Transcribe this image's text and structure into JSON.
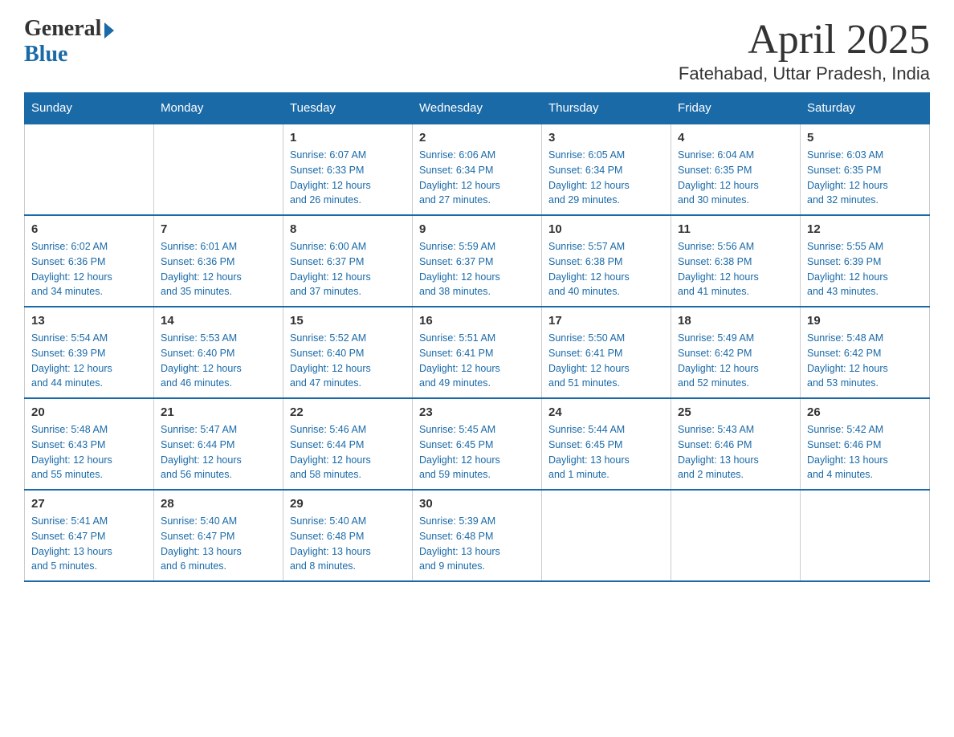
{
  "header": {
    "logo": {
      "general": "General",
      "blue": "Blue"
    },
    "title": "April 2025",
    "subtitle": "Fatehabad, Uttar Pradesh, India"
  },
  "calendar": {
    "headers": [
      "Sunday",
      "Monday",
      "Tuesday",
      "Wednesday",
      "Thursday",
      "Friday",
      "Saturday"
    ],
    "weeks": [
      {
        "days": [
          {
            "number": "",
            "info": ""
          },
          {
            "number": "",
            "info": ""
          },
          {
            "number": "1",
            "info": "Sunrise: 6:07 AM\nSunset: 6:33 PM\nDaylight: 12 hours\nand 26 minutes."
          },
          {
            "number": "2",
            "info": "Sunrise: 6:06 AM\nSunset: 6:34 PM\nDaylight: 12 hours\nand 27 minutes."
          },
          {
            "number": "3",
            "info": "Sunrise: 6:05 AM\nSunset: 6:34 PM\nDaylight: 12 hours\nand 29 minutes."
          },
          {
            "number": "4",
            "info": "Sunrise: 6:04 AM\nSunset: 6:35 PM\nDaylight: 12 hours\nand 30 minutes."
          },
          {
            "number": "5",
            "info": "Sunrise: 6:03 AM\nSunset: 6:35 PM\nDaylight: 12 hours\nand 32 minutes."
          }
        ]
      },
      {
        "days": [
          {
            "number": "6",
            "info": "Sunrise: 6:02 AM\nSunset: 6:36 PM\nDaylight: 12 hours\nand 34 minutes."
          },
          {
            "number": "7",
            "info": "Sunrise: 6:01 AM\nSunset: 6:36 PM\nDaylight: 12 hours\nand 35 minutes."
          },
          {
            "number": "8",
            "info": "Sunrise: 6:00 AM\nSunset: 6:37 PM\nDaylight: 12 hours\nand 37 minutes."
          },
          {
            "number": "9",
            "info": "Sunrise: 5:59 AM\nSunset: 6:37 PM\nDaylight: 12 hours\nand 38 minutes."
          },
          {
            "number": "10",
            "info": "Sunrise: 5:57 AM\nSunset: 6:38 PM\nDaylight: 12 hours\nand 40 minutes."
          },
          {
            "number": "11",
            "info": "Sunrise: 5:56 AM\nSunset: 6:38 PM\nDaylight: 12 hours\nand 41 minutes."
          },
          {
            "number": "12",
            "info": "Sunrise: 5:55 AM\nSunset: 6:39 PM\nDaylight: 12 hours\nand 43 minutes."
          }
        ]
      },
      {
        "days": [
          {
            "number": "13",
            "info": "Sunrise: 5:54 AM\nSunset: 6:39 PM\nDaylight: 12 hours\nand 44 minutes."
          },
          {
            "number": "14",
            "info": "Sunrise: 5:53 AM\nSunset: 6:40 PM\nDaylight: 12 hours\nand 46 minutes."
          },
          {
            "number": "15",
            "info": "Sunrise: 5:52 AM\nSunset: 6:40 PM\nDaylight: 12 hours\nand 47 minutes."
          },
          {
            "number": "16",
            "info": "Sunrise: 5:51 AM\nSunset: 6:41 PM\nDaylight: 12 hours\nand 49 minutes."
          },
          {
            "number": "17",
            "info": "Sunrise: 5:50 AM\nSunset: 6:41 PM\nDaylight: 12 hours\nand 51 minutes."
          },
          {
            "number": "18",
            "info": "Sunrise: 5:49 AM\nSunset: 6:42 PM\nDaylight: 12 hours\nand 52 minutes."
          },
          {
            "number": "19",
            "info": "Sunrise: 5:48 AM\nSunset: 6:42 PM\nDaylight: 12 hours\nand 53 minutes."
          }
        ]
      },
      {
        "days": [
          {
            "number": "20",
            "info": "Sunrise: 5:48 AM\nSunset: 6:43 PM\nDaylight: 12 hours\nand 55 minutes."
          },
          {
            "number": "21",
            "info": "Sunrise: 5:47 AM\nSunset: 6:44 PM\nDaylight: 12 hours\nand 56 minutes."
          },
          {
            "number": "22",
            "info": "Sunrise: 5:46 AM\nSunset: 6:44 PM\nDaylight: 12 hours\nand 58 minutes."
          },
          {
            "number": "23",
            "info": "Sunrise: 5:45 AM\nSunset: 6:45 PM\nDaylight: 12 hours\nand 59 minutes."
          },
          {
            "number": "24",
            "info": "Sunrise: 5:44 AM\nSunset: 6:45 PM\nDaylight: 13 hours\nand 1 minute."
          },
          {
            "number": "25",
            "info": "Sunrise: 5:43 AM\nSunset: 6:46 PM\nDaylight: 13 hours\nand 2 minutes."
          },
          {
            "number": "26",
            "info": "Sunrise: 5:42 AM\nSunset: 6:46 PM\nDaylight: 13 hours\nand 4 minutes."
          }
        ]
      },
      {
        "days": [
          {
            "number": "27",
            "info": "Sunrise: 5:41 AM\nSunset: 6:47 PM\nDaylight: 13 hours\nand 5 minutes."
          },
          {
            "number": "28",
            "info": "Sunrise: 5:40 AM\nSunset: 6:47 PM\nDaylight: 13 hours\nand 6 minutes."
          },
          {
            "number": "29",
            "info": "Sunrise: 5:40 AM\nSunset: 6:48 PM\nDaylight: 13 hours\nand 8 minutes."
          },
          {
            "number": "30",
            "info": "Sunrise: 5:39 AM\nSunset: 6:48 PM\nDaylight: 13 hours\nand 9 minutes."
          },
          {
            "number": "",
            "info": ""
          },
          {
            "number": "",
            "info": ""
          },
          {
            "number": "",
            "info": ""
          }
        ]
      }
    ]
  }
}
